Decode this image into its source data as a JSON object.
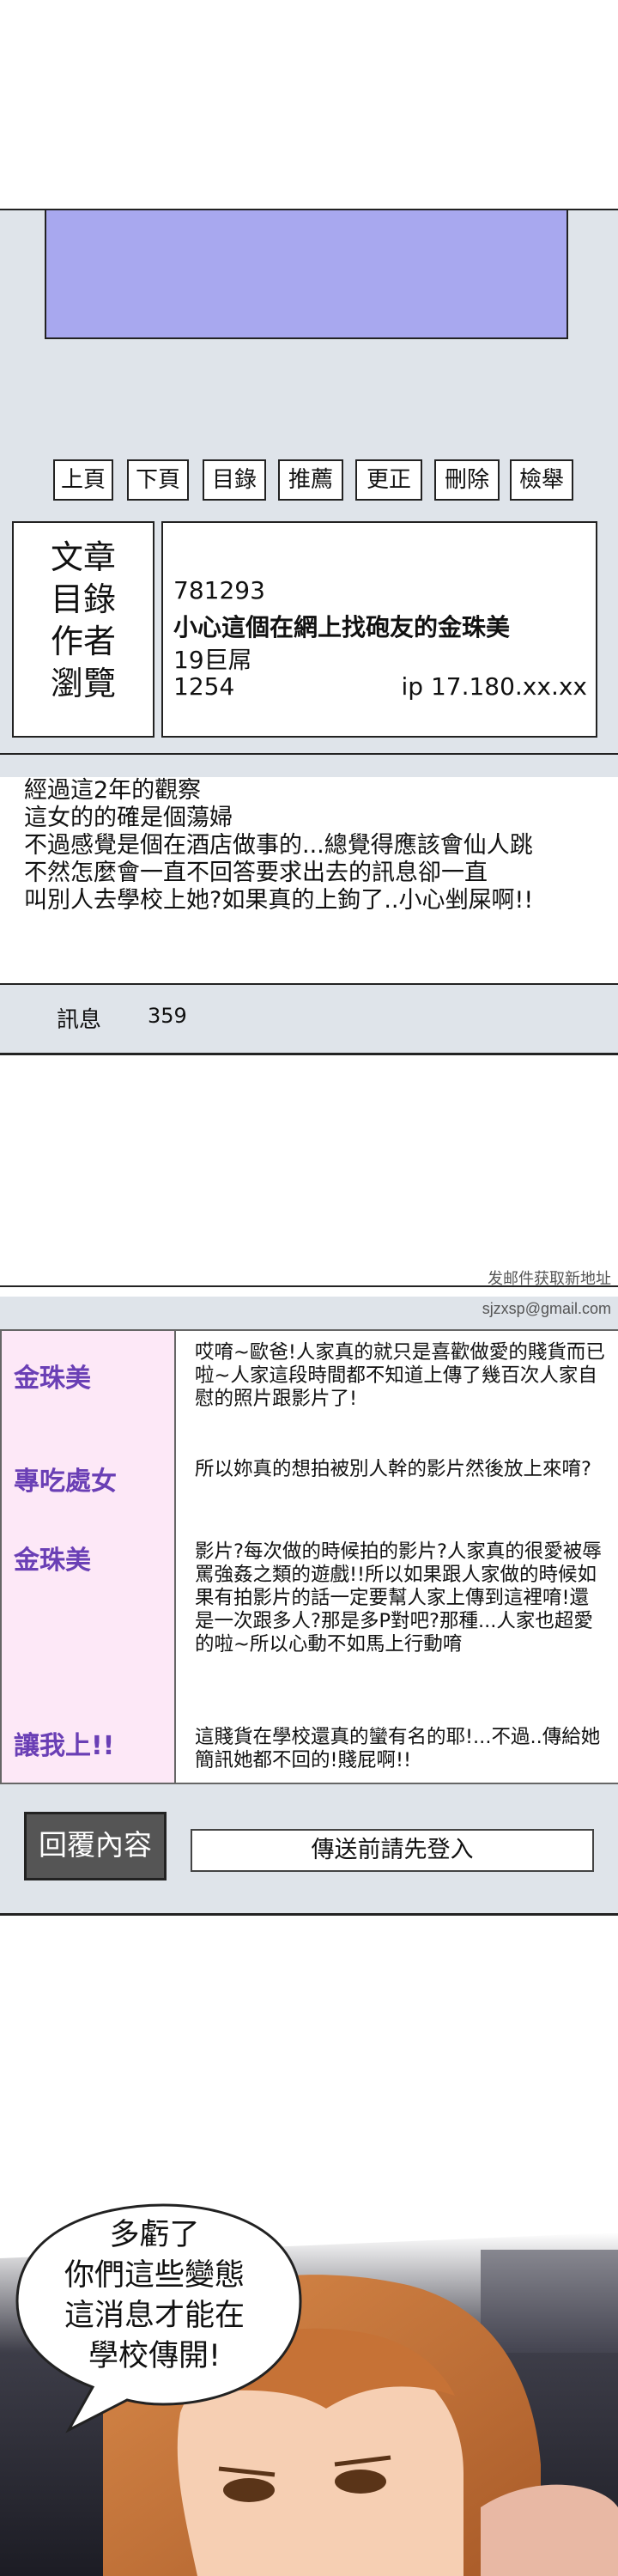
{
  "nav": {
    "buttons": [
      "上頁",
      "下頁",
      "目錄",
      "推薦",
      "更正",
      "刪除",
      "檢舉"
    ]
  },
  "meta": {
    "labels": [
      "文章",
      "目錄",
      "作者",
      "瀏覽"
    ],
    "article_id": "781293",
    "title": "小心這個在網上找砲友的金珠美",
    "author": "19巨屌",
    "views": "1254",
    "ip": "ip 17.180.xx.xx"
  },
  "post": {
    "lines": [
      "經過這2年的觀察",
      "這女的的確是個蕩婦",
      "不過感覺是個在酒店做事的...總覺得應該會仙人跳",
      "不然怎麼會一直不回答要求出去的訊息卻一直",
      "叫別人去學校上她?如果真的上鉤了..小心剉屎啊!!"
    ]
  },
  "messages_bar": {
    "label": "訊息",
    "count": "359"
  },
  "watermark": {
    "line1": "发邮件获取新地址",
    "line2": "sjzxsp@gmail.com"
  },
  "chat": {
    "entries": [
      {
        "name": "金珠美",
        "text": "哎唷~歐爸!人家真的就只是喜歡做愛的賤貨而已啦~人家這段時間都不知道上傳了幾百次人家自慰的照片跟影片了!"
      },
      {
        "name": "專吃處女",
        "text": "所以妳真的想拍被別人幹的影片然後放上來唷?"
      },
      {
        "name": "金珠美",
        "text": "影片?每次做的時候拍的影片?人家真的很愛被辱罵強姦之類的遊戲!!所以如果跟人家做的時候如果有拍影片的話一定要幫人家上傳到這裡唷!還是一次跟多人?那是多P對吧?那種...人家也超愛的啦~所以心動不如馬上行動唷"
      },
      {
        "name": "讓我上!!",
        "text": "這賤貨在學校還真的蠻有名的耶!...不過..傳給她簡訊她都不回的!賤屁啊!!"
      }
    ],
    "reply_button": "回覆內容",
    "login_prompt": "傳送前請先登入"
  },
  "comic": {
    "speech_lines": [
      "多虧了",
      "你們這些變態",
      "這消息才能在",
      "學校傳開!"
    ]
  }
}
